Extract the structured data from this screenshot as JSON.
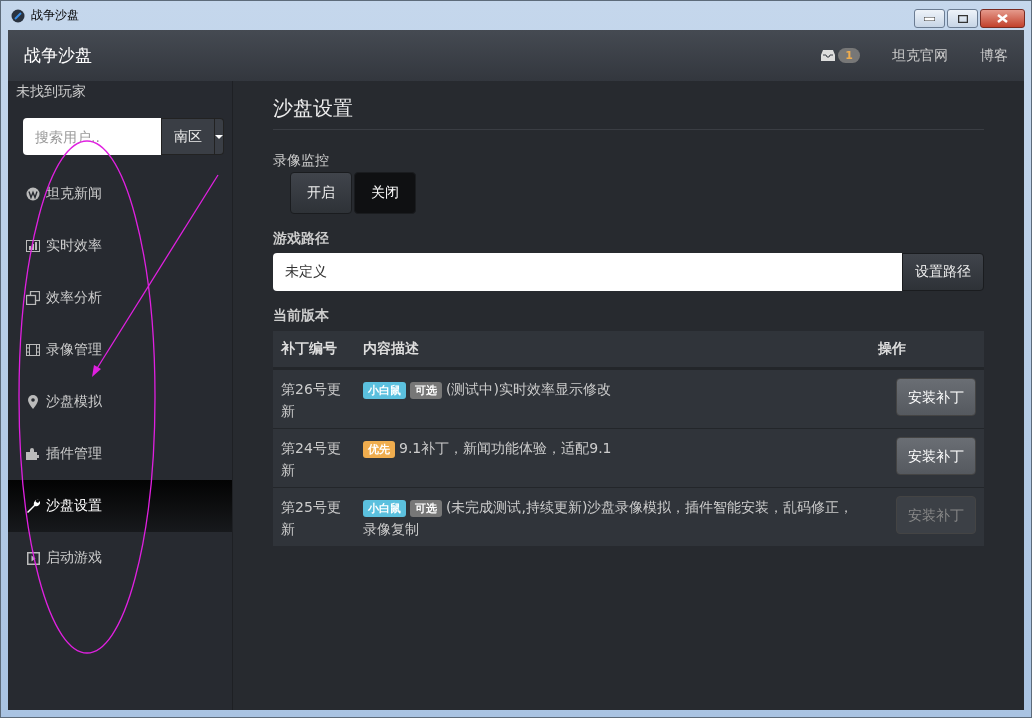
{
  "window": {
    "title": "战争沙盘"
  },
  "header": {
    "brand": "战争沙盘",
    "inbox_count": "1",
    "links": [
      "坦克官网",
      "博客"
    ]
  },
  "sidebar": {
    "status": "未找到玩家",
    "search": {
      "placeholder": "搜索用户.."
    },
    "region": "南区",
    "items": [
      {
        "label": "坦克新闻",
        "selected": false
      },
      {
        "label": "实时效率",
        "selected": false
      },
      {
        "label": "效率分析",
        "selected": false
      },
      {
        "label": "录像管理",
        "selected": false
      },
      {
        "label": "沙盘模拟",
        "selected": false
      },
      {
        "label": "插件管理",
        "selected": false
      },
      {
        "label": "沙盘设置",
        "selected": true
      },
      {
        "label": "启动游戏",
        "selected": false
      }
    ]
  },
  "main": {
    "title": "沙盘设置",
    "recording_label": "录像监控",
    "recording_options": [
      {
        "label": "开启",
        "selected": false
      },
      {
        "label": "关闭",
        "selected": true
      }
    ],
    "path_label": "游戏路径",
    "path_value": "未定义",
    "path_button": "设置路径",
    "version_label": "当前版本",
    "table": {
      "columns": [
        "补丁编号",
        "内容描述",
        "操作"
      ],
      "rows": [
        {
          "patch": "第26号更新",
          "tags": [
            {
              "label": "小白鼠",
              "kind": "info"
            },
            {
              "label": "可选",
              "kind": "default"
            }
          ],
          "description": "(测试中)实时效率显示修改",
          "button": {
            "label": "安装补丁",
            "disabled": false
          }
        },
        {
          "patch": "第24号更新",
          "tags": [
            {
              "label": "优先",
              "kind": "warning"
            }
          ],
          "description": "9.1补丁，新闻功能体验，适配9.1",
          "button": {
            "label": "安装补丁",
            "disabled": false
          }
        },
        {
          "patch": "第25号更新",
          "tags": [
            {
              "label": "小白鼠",
              "kind": "info"
            },
            {
              "label": "可选",
              "kind": "default"
            }
          ],
          "description": "(未完成测试,持续更新)沙盘录像模拟，插件智能安装，乱码修正，录像复制",
          "button": {
            "label": "安装补丁",
            "disabled": true
          }
        }
      ]
    }
  }
}
